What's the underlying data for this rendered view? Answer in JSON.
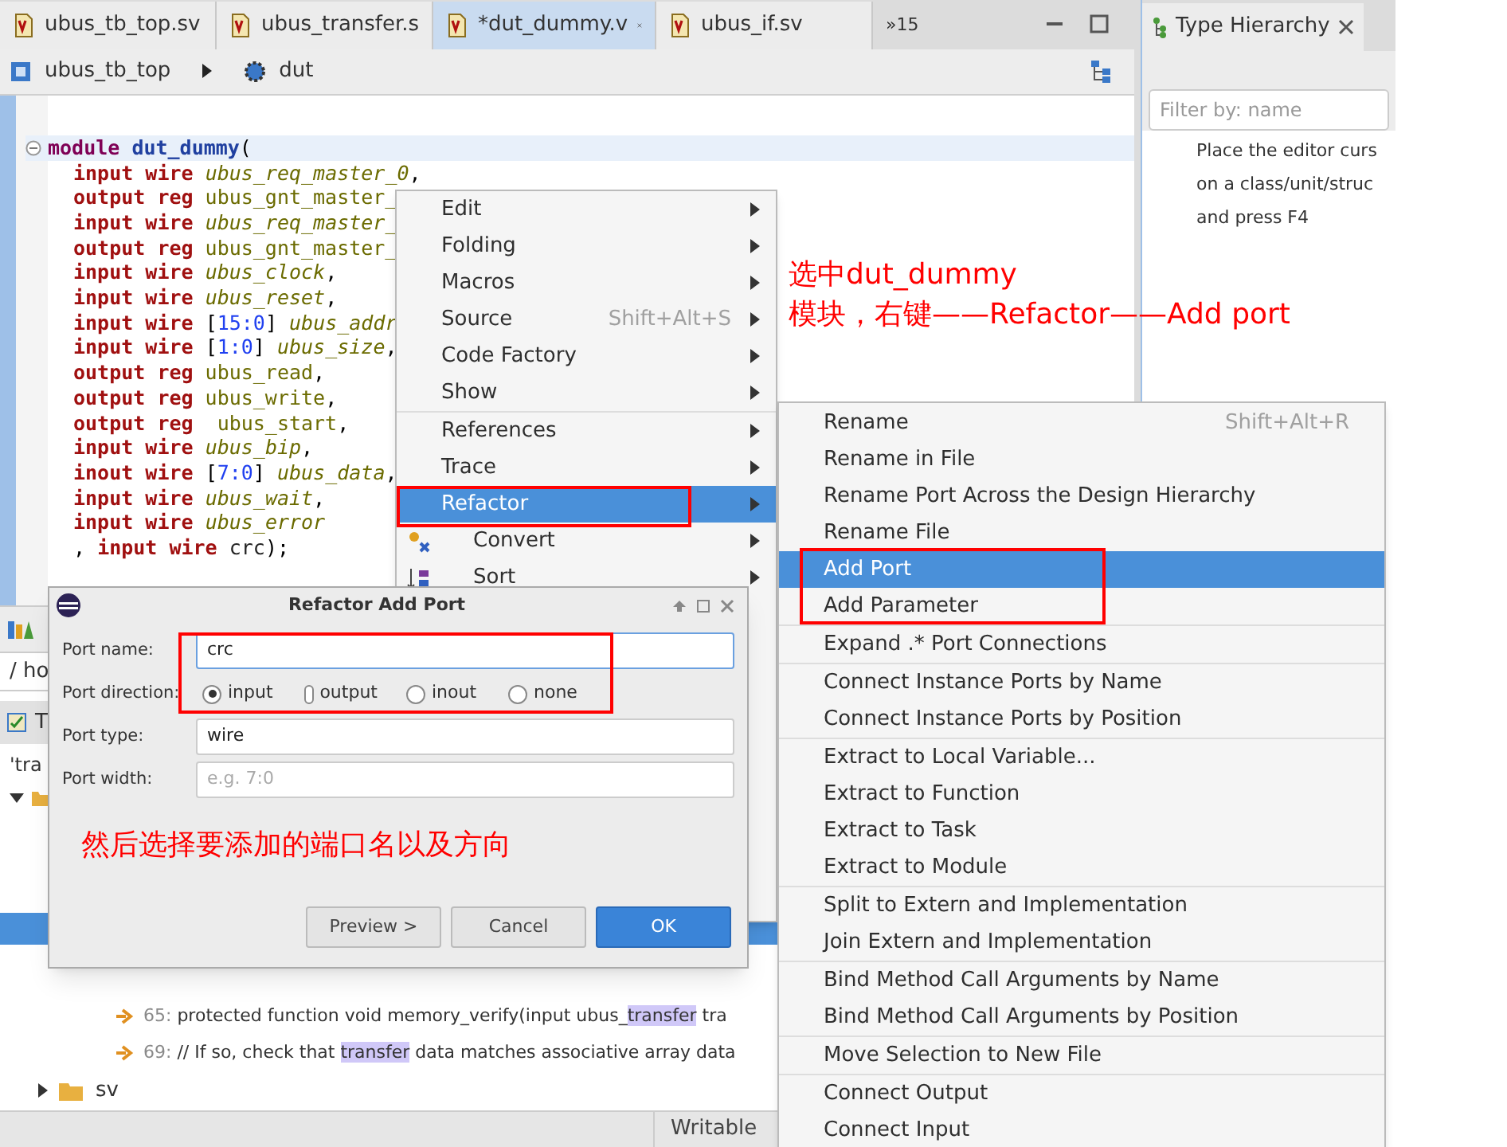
{
  "editor_tabs": [
    {
      "label": "ubus_tb_top.sv",
      "selected": false
    },
    {
      "label": "ubus_transfer.s",
      "selected": false
    },
    {
      "label": "*dut_dummy.v",
      "selected": true
    },
    {
      "label": "ubus_if.sv",
      "selected": false
    }
  ],
  "tab_overflow": "»15",
  "breadcrumb": [
    "ubus_tb_top",
    "dut"
  ],
  "code": {
    "keyword": "module",
    "name": "dut_dummy",
    "tail": "(",
    "lines": [
      {
        "dir": "input",
        "type": "wire",
        "name": "ubus_req_master_0",
        "tail": ",",
        "italic": true
      },
      {
        "dir": "output",
        "type": "reg",
        "name": "ubus_gnt_master_",
        "italic": false
      },
      {
        "dir": "input",
        "type": "wire",
        "name": "ubus_req_master_",
        "italic": true
      },
      {
        "dir": "output",
        "type": "reg",
        "name": "ubus_gnt_master_",
        "italic": false
      },
      {
        "dir": "input",
        "type": "wire",
        "name": "ubus_clock",
        "tail": ",",
        "italic": true
      },
      {
        "dir": "input",
        "type": "wire",
        "name": "ubus_reset",
        "tail": ",",
        "italic": true
      },
      {
        "dir": "input",
        "type": "wire",
        "range": "[15:0]",
        "name": "ubus_addr",
        "italic": true
      },
      {
        "dir": "input",
        "type": "wire",
        "range": "[1:0]",
        "name": "ubus_size",
        "tail": ",",
        "italic": true
      },
      {
        "dir": "output",
        "type": "reg",
        "name": "ubus_read",
        "tail": ",",
        "italic": false
      },
      {
        "dir": "output",
        "type": "reg",
        "name": "ubus_write",
        "tail": ",",
        "italic": false
      },
      {
        "dir": "output",
        "type": "reg",
        "name": " ubus_start",
        "tail": ",",
        "italic": false
      },
      {
        "dir": "input",
        "type": "wire",
        "name": "ubus_bip",
        "tail": ",",
        "italic": true
      },
      {
        "dir": "inout",
        "type": "wire",
        "range": "[7:0]",
        "name": "ubus_data",
        "tail": ",",
        "italic": true
      },
      {
        "dir": "input",
        "type": "wire",
        "name": "ubus_wait",
        "tail": ",",
        "italic": true
      },
      {
        "dir": "input",
        "type": "wire",
        "name": "ubus_error",
        "italic": true
      },
      {
        "lead": ",",
        "dir": "input",
        "type": "wire",
        "name": "crc",
        "tail": ");",
        "italic": false
      }
    ]
  },
  "right_panel": {
    "tab": "Type Hierarchy",
    "filter_placeholder": "Filter by: name",
    "message": [
      "Place the editor curs",
      "on a class/unit/struc",
      "and press F4"
    ]
  },
  "bottom_panel": {
    "path": "/ ho",
    "tab": "T",
    "filter": "'tra",
    "results": [
      {
        "line": "65:",
        "before": "protected function void memory_verify(input ubus_",
        "match": "transfer",
        "after": " tra"
      },
      {
        "line": "69:",
        "before": "// If so, check that ",
        "match": "transfer",
        "after": " data matches associative array data"
      }
    ],
    "folder": "sv"
  },
  "status_bar": {
    "mode": "Writable"
  },
  "context_menu": {
    "groups": [
      [
        {
          "label": "Edit",
          "selected": false,
          "kind": "plain"
        },
        {
          "label": "Folding",
          "selected": false,
          "kind": "plain"
        },
        {
          "label": "Macros",
          "selected": false,
          "kind": "plain"
        },
        {
          "label": "Source",
          "shortcut": "Shift+Alt+S",
          "selected": false,
          "kind": "plain"
        },
        {
          "label": "Code Factory",
          "selected": false,
          "kind": "plain"
        },
        {
          "label": "Show",
          "selected": false,
          "kind": "plain"
        }
      ],
      [
        {
          "label": "References",
          "selected": false,
          "kind": "plain"
        },
        {
          "label": "Trace",
          "selected": false,
          "kind": "plain"
        },
        {
          "label": "Refactor",
          "selected": true,
          "kind": "plain"
        },
        {
          "label": "Convert",
          "selected": false,
          "kind": "convert"
        },
        {
          "label": "Sort",
          "selected": false,
          "kind": "sort"
        }
      ]
    ]
  },
  "submenu": {
    "groups": [
      [
        {
          "label": "Rename",
          "shortcut": "Shift+Alt+R",
          "selected": false
        },
        {
          "label": "Rename in File",
          "selected": false
        },
        {
          "label": "Rename Port Across the Design Hierarchy",
          "selected": false
        },
        {
          "label": "Rename File",
          "selected": false
        },
        {
          "label": "Add Port",
          "selected": true
        },
        {
          "label": "Add Parameter",
          "selected": false
        }
      ],
      [
        {
          "label": "Expand .* Port Connections",
          "selected": false
        }
      ],
      [
        {
          "label": "Connect Instance Ports by Name",
          "selected": false
        },
        {
          "label": "Connect Instance Ports by Position",
          "selected": false
        }
      ],
      [
        {
          "label": "Extract to Local Variable...",
          "selected": false
        },
        {
          "label": "Extract to Function",
          "selected": false
        },
        {
          "label": "Extract to Task",
          "selected": false
        },
        {
          "label": "Extract to Module",
          "selected": false
        }
      ],
      [
        {
          "label": "Split to Extern and Implementation",
          "selected": false
        },
        {
          "label": "Join Extern and Implementation",
          "selected": false
        }
      ],
      [
        {
          "label": "Bind Method Call Arguments by Name",
          "selected": false
        },
        {
          "label": "Bind Method Call Arguments by Position",
          "selected": false
        }
      ],
      [
        {
          "label": "Move Selection to New File",
          "selected": false
        }
      ],
      [
        {
          "label": "Connect Output",
          "selected": false
        },
        {
          "label": "Connect Input",
          "selected": false
        }
      ]
    ]
  },
  "dialog": {
    "title": "Refactor Add Port",
    "fields": [
      {
        "label": "Port name:",
        "kind": "text",
        "value": "crc"
      },
      {
        "label": "Port direction:",
        "kind": "radio",
        "options": [
          {
            "label": "input",
            "selected": true
          },
          {
            "label": "output",
            "selected": false
          },
          {
            "label": "inout",
            "selected": false
          },
          {
            "label": "none",
            "selected": false
          }
        ]
      },
      {
        "label": "Port type:",
        "kind": "text",
        "value": "wire"
      },
      {
        "label": "Port width:",
        "kind": "text",
        "placeholder": "e.g. 7:0"
      }
    ],
    "buttons": [
      {
        "label": "Preview >",
        "primary": false
      },
      {
        "label": "Cancel",
        "primary": false
      },
      {
        "label": "OK",
        "primary": true
      }
    ]
  },
  "annotations": [
    "选中dut_dummy",
    "模块，右键——Refactor——Add  port",
    "然后选择要添加的端口名以及方向"
  ]
}
